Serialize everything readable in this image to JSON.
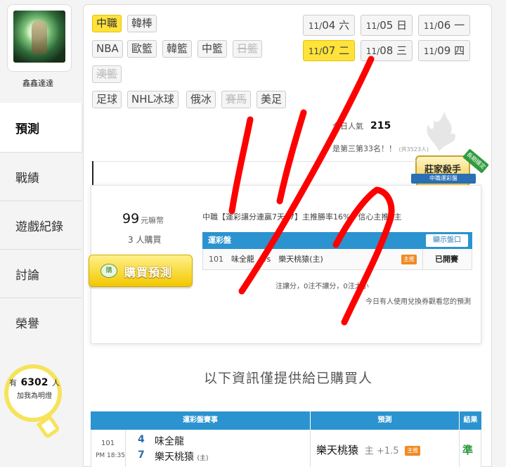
{
  "user": {
    "name": "鑫鑫達達"
  },
  "nav": {
    "items": [
      {
        "label": "預測",
        "active": true
      },
      {
        "label": "戰績",
        "active": false
      },
      {
        "label": "遊戲紀錄",
        "active": false
      },
      {
        "label": "討論",
        "active": false
      },
      {
        "label": "榮譽",
        "active": false
      }
    ]
  },
  "fans": {
    "prefix": "有",
    "count": "6302",
    "suffix": "人",
    "subtitle": "加我為明燈"
  },
  "sports": {
    "row1": [
      "中職",
      "韓棒"
    ],
    "row2": [
      "NBA",
      "歐籃",
      "韓籃",
      "中籃",
      "日籃"
    ],
    "row3": [
      "澳籃"
    ],
    "row4": [
      "足球",
      "NHL冰球",
      "俄冰",
      "賽馬",
      "美足"
    ],
    "active": "中職"
  },
  "dates": [
    {
      "month": "11/",
      "day": "04",
      "weekday": "六"
    },
    {
      "month": "11/",
      "day": "05",
      "weekday": "日"
    },
    {
      "month": "11/",
      "day": "06",
      "weekday": "一"
    },
    {
      "month": "11/",
      "day": "07",
      "weekday": "二",
      "active": true
    },
    {
      "month": "11/",
      "day": "08",
      "weekday": "三"
    },
    {
      "month": "11/",
      "day": "09",
      "weekday": "四"
    }
  ],
  "stats": {
    "today_visitors_label": "今日人氣",
    "today_visitors": "215",
    "rank_text": "是第三第33名！！",
    "rank_note": "(共3523人)"
  },
  "badge": {
    "title": "莊家殺手",
    "ribbon": "中職運彩盤",
    "tag": "長期穩定"
  },
  "prediction": {
    "price": "99",
    "price_unit": "元嘛幣",
    "buyers": "3 人購買",
    "buy_button": "購買預測",
    "buy_icon": "購",
    "title": "中職【運彩讓分連贏7天17】主推勝率16%，信心主推1主",
    "table_header": "運彩盤",
    "show_odds_button": "顯示盤口",
    "row": {
      "id": "101",
      "teams": "味全龍　vs　樂天桃猿(主)",
      "tag": "主推",
      "status": "已開賽"
    },
    "note1": "注讓分，0注不讓分，0注大小",
    "note2": "今日有人使用兌換券觀看您的預測"
  },
  "info_heading": "以下資訊僅提供給已購買人",
  "results": {
    "headers": {
      "match": "運彩盤賽事",
      "prediction": "預測",
      "result": "結果"
    },
    "row": {
      "id": "101",
      "time": "PM 18:35",
      "score_away": "4",
      "score_home": "7",
      "away": "味全龍",
      "home": "樂天桃猿",
      "home_mark": "(主)",
      "pick_team": "樂天桃猿",
      "pick_side": "主",
      "pick_spread": "+1.5",
      "pick_tag": "主推",
      "verdict": "準"
    }
  },
  "annotation": {
    "handwritten_text": "11/7",
    "color": "#ff0000"
  },
  "colors": {
    "accent": "#ffe23a",
    "header_blue": "#2b93cf",
    "win_green": "#2a9a3a",
    "tag_orange": "#f08a24"
  }
}
